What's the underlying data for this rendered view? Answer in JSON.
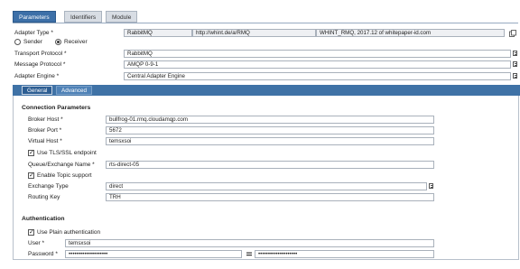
{
  "tabs": [
    {
      "label": "Parameters",
      "active": true
    },
    {
      "label": "Identifiers",
      "active": false
    },
    {
      "label": "Module",
      "active": false
    }
  ],
  "adapter": {
    "type_label": "Adapter Type *",
    "type_value": "RabbitMQ",
    "url_value": "http://whint.de/a/RMQ",
    "version_value": "WHINT_RMQ, 2017.12 of whitepaper-id.com"
  },
  "direction": {
    "sender_label": "Sender",
    "receiver_label": "Receiver",
    "selected": "Receiver"
  },
  "transport": {
    "label": "Transport Protocol *",
    "value": "RabbitMQ"
  },
  "message": {
    "label": "Message Protocol *",
    "value": "AMQP 0-9-1"
  },
  "engine": {
    "label": "Adapter Engine *",
    "value": "Central Adapter Engine"
  },
  "subtabs": [
    {
      "label": "General",
      "active": true
    },
    {
      "label": "Advanced",
      "active": false
    }
  ],
  "connection": {
    "title": "Connection Parameters",
    "broker_host_label": "Broker Host *",
    "broker_host_value": "bullfrog-01.rmq.cloudamqp.com",
    "broker_port_label": "Broker Port *",
    "broker_port_value": "5672",
    "vhost_label": "Virtual Host *",
    "vhost_value": "temsxsoi",
    "tls_label": "Use TLS/SSL endpoint",
    "tls_checked": true,
    "queue_label": "Queue/Exchange Name *",
    "queue_value": "rts-direct-05",
    "topic_label": "Enable Topic support",
    "topic_checked": true,
    "exchange_type_label": "Exchange Type",
    "exchange_type_value": "direct",
    "routing_key_label": "Routing Key",
    "routing_key_value": "TRH"
  },
  "authentication": {
    "title": "Authentication",
    "plain_label": "Use Plain authentication",
    "plain_checked": true,
    "user_label": "User *",
    "user_value": "temsxsoi",
    "password_label": "Password *",
    "password_value": "••••••••••••••••••••",
    "password_confirm_value": "••••••••••••••••••••"
  },
  "icons": {
    "dropdown": "list-dropdown-icon",
    "copy": "copy-icon",
    "password_match": "equals-icon"
  },
  "colors": {
    "tab_active": "#3d70a8",
    "subbar": "#3f72a6"
  }
}
